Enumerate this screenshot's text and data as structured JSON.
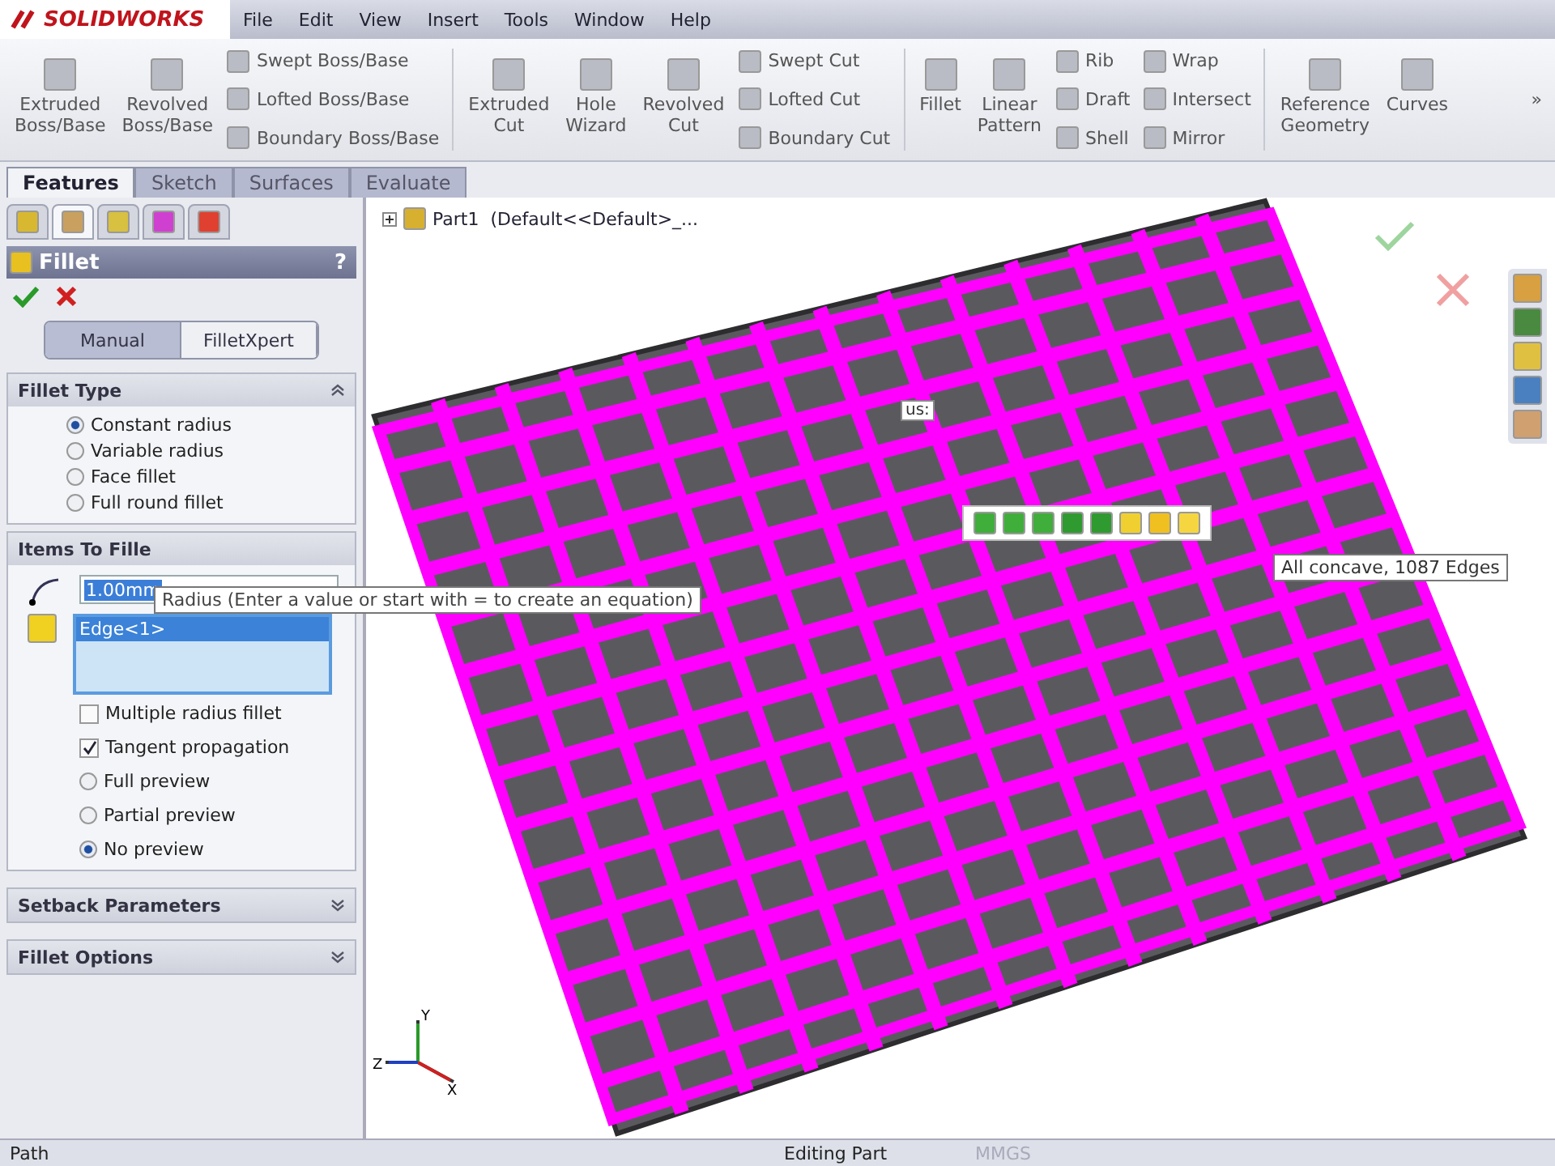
{
  "app": {
    "logo": "SOLIDWORKS",
    "menu": [
      "File",
      "Edit",
      "View",
      "Insert",
      "Tools",
      "Window",
      "Help"
    ]
  },
  "ribbon": [
    {
      "kind": "large",
      "label": "Extruded\nBoss/Base"
    },
    {
      "kind": "large",
      "label": "Revolved\nBoss/Base"
    },
    {
      "kind": "stack",
      "items": [
        "Swept Boss/Base",
        "Lofted Boss/Base",
        "Boundary Boss/Base"
      ]
    },
    {
      "kind": "divider"
    },
    {
      "kind": "large",
      "label": "Extruded\nCut"
    },
    {
      "kind": "large",
      "label": "Hole\nWizard"
    },
    {
      "kind": "large",
      "label": "Revolved\nCut"
    },
    {
      "kind": "stack",
      "items": [
        "Swept Cut",
        "Lofted Cut",
        "Boundary Cut"
      ]
    },
    {
      "kind": "divider"
    },
    {
      "kind": "large",
      "label": "Fillet"
    },
    {
      "kind": "large",
      "label": "Linear\nPattern"
    },
    {
      "kind": "stack",
      "items": [
        "Rib",
        "Draft",
        "Shell"
      ]
    },
    {
      "kind": "stack",
      "items": [
        "Wrap",
        "Intersect",
        "Mirror"
      ]
    },
    {
      "kind": "divider"
    },
    {
      "kind": "large",
      "label": "Reference\nGeometry"
    },
    {
      "kind": "large",
      "label": "Curves"
    }
  ],
  "ribbon_more": "»",
  "tabs": [
    {
      "label": "Features",
      "selected": true
    },
    {
      "label": "Sketch",
      "selected": false
    },
    {
      "label": "Surfaces",
      "selected": false
    },
    {
      "label": "Evaluate",
      "selected": false
    }
  ],
  "panel": {
    "manager_tabs": [
      {
        "selected": false
      },
      {
        "selected": true
      },
      {
        "selected": false
      },
      {
        "selected": false
      },
      {
        "selected": false
      }
    ],
    "title": "Fillet",
    "help": "?",
    "modes": [
      {
        "label": "Manual",
        "selected": true
      },
      {
        "label": "FilletXpert",
        "selected": false
      }
    ],
    "fillet_type": {
      "title": "Fillet Type",
      "expanded": true,
      "options": [
        {
          "label": "Constant radius",
          "selected": true
        },
        {
          "label": "Variable radius",
          "selected": false
        },
        {
          "label": "Face fillet",
          "selected": false
        },
        {
          "label": "Full round fillet",
          "selected": false
        }
      ]
    },
    "items": {
      "title": "Items To Fille",
      "radius": "1.00mm",
      "edges": [
        {
          "label": "Edge<1>",
          "selected": true
        }
      ],
      "checks": [
        {
          "label": "Multiple radius fillet",
          "checked": false
        },
        {
          "label": "Tangent propagation",
          "checked": true
        }
      ],
      "preview": [
        {
          "label": "Full preview",
          "selected": false
        },
        {
          "label": "Partial preview",
          "selected": false
        },
        {
          "label": "No preview",
          "selected": true
        }
      ]
    },
    "collapsed": [
      {
        "title": "Setback Parameters",
        "expanded": false
      },
      {
        "title": "Fillet Options",
        "expanded": false
      }
    ],
    "tooltip": "Radius (Enter a value or start with = to create an equation)"
  },
  "viewport": {
    "tree_label": "Part1  (Default<<Default>_...",
    "callout": "us:",
    "selection_tooltip": "All concave, 1087 Edges",
    "axes": [
      "X",
      "Y",
      "Z"
    ]
  },
  "status_bar": {
    "left": "Path",
    "mode": "Editing Part",
    "units": "MMGS"
  }
}
